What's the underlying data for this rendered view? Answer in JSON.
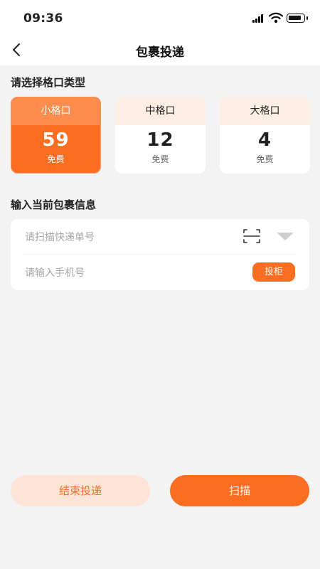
{
  "status_bar": {
    "time": "09:36"
  },
  "nav": {
    "title": "包裹投递"
  },
  "size_section": {
    "title": "请选择格口类型",
    "selected": 0,
    "cards": [
      {
        "label": "小格口",
        "count": "59",
        "fee": "免费"
      },
      {
        "label": "中格口",
        "count": "12",
        "fee": "免费"
      },
      {
        "label": "大格口",
        "count": "4",
        "fee": "免费"
      }
    ]
  },
  "info_section": {
    "title": "输入当前包裹信息",
    "tracking_placeholder": "请扫描快递单号",
    "phone_placeholder": "请输入手机号",
    "deposit_label": "投柜"
  },
  "actions": {
    "end_label": "结束投递",
    "scan_label": "扫描"
  },
  "colors": {
    "accent": "#fb6d21",
    "accent_light": "#fde4d7",
    "card_head": "#fdeee6"
  }
}
